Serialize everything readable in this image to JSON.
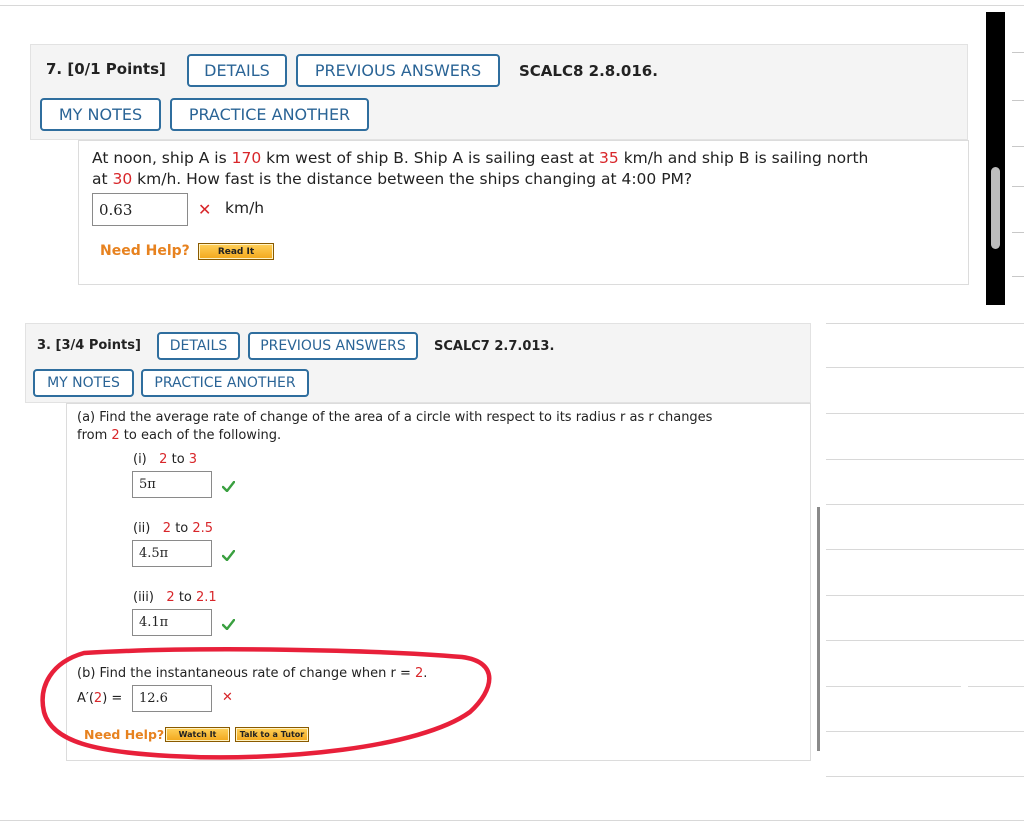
{
  "q7": {
    "number": "7.",
    "points": "[0/1 Points]",
    "details_label": "DETAILS",
    "previous_answers_label": "PREVIOUS ANSWERS",
    "code": "SCALC8 2.8.016.",
    "my_notes_label": "MY NOTES",
    "practice_another_label": "PRACTICE ANOTHER",
    "text": {
      "p1": "At noon, ship A is ",
      "dist": "170",
      "p2": " km west of ship B. Ship A is sailing east at ",
      "speedA": "35",
      "p3": " km/h and ship B is sailing north",
      "p4": "at ",
      "speedB": "30",
      "p5": " km/h. How fast is the distance between the ships changing at 4:00 PM?"
    },
    "answer": "0.63",
    "unit": "km/h",
    "need_help": "Need Help?",
    "read_it_label": "Read It"
  },
  "q3": {
    "number": "3.",
    "points": "[3/4 Points]",
    "details_label": "DETAILS",
    "previous_answers_label": "PREVIOUS ANSWERS",
    "code": "SCALC7 2.7.013.",
    "my_notes_label": "MY NOTES",
    "practice_another_label": "PRACTICE ANOTHER",
    "part_a": {
      "line1": "(a) Find the average rate of change of the area of a circle with respect to its radius r as r changes",
      "line2_pre": "from ",
      "line2_num": "2",
      "line2_post": " to each of the following.",
      "items": [
        {
          "label": "(i)",
          "from": "2",
          "to_word": "to",
          "to": "3",
          "answer": "5π"
        },
        {
          "label": "(ii)",
          "from": "2",
          "to_word": "to",
          "to": "2.5",
          "answer": "4.5π"
        },
        {
          "label": "(iii)",
          "from": "2",
          "to_word": "to",
          "to": "2.1",
          "answer": "4.1π"
        }
      ]
    },
    "part_b": {
      "text_pre": "(b) Find the instantaneous rate of change when r = ",
      "text_num": "2",
      "text_post": ".",
      "lhs_pre": "A′(",
      "lhs_num": "2",
      "lhs_post": ")  =",
      "answer": "12.6"
    },
    "need_help": "Need Help?",
    "watch_it_label": "Watch It",
    "talk_tutor_label": "Talk to a Tutor"
  },
  "colors": {
    "button_border": "#2f6e9e",
    "button_text": "#2a6496",
    "highlight_red": "#d8262a",
    "help_orange": "#e7821f",
    "correct_green": "#3aa040",
    "annotation_red": "#e8203a"
  }
}
